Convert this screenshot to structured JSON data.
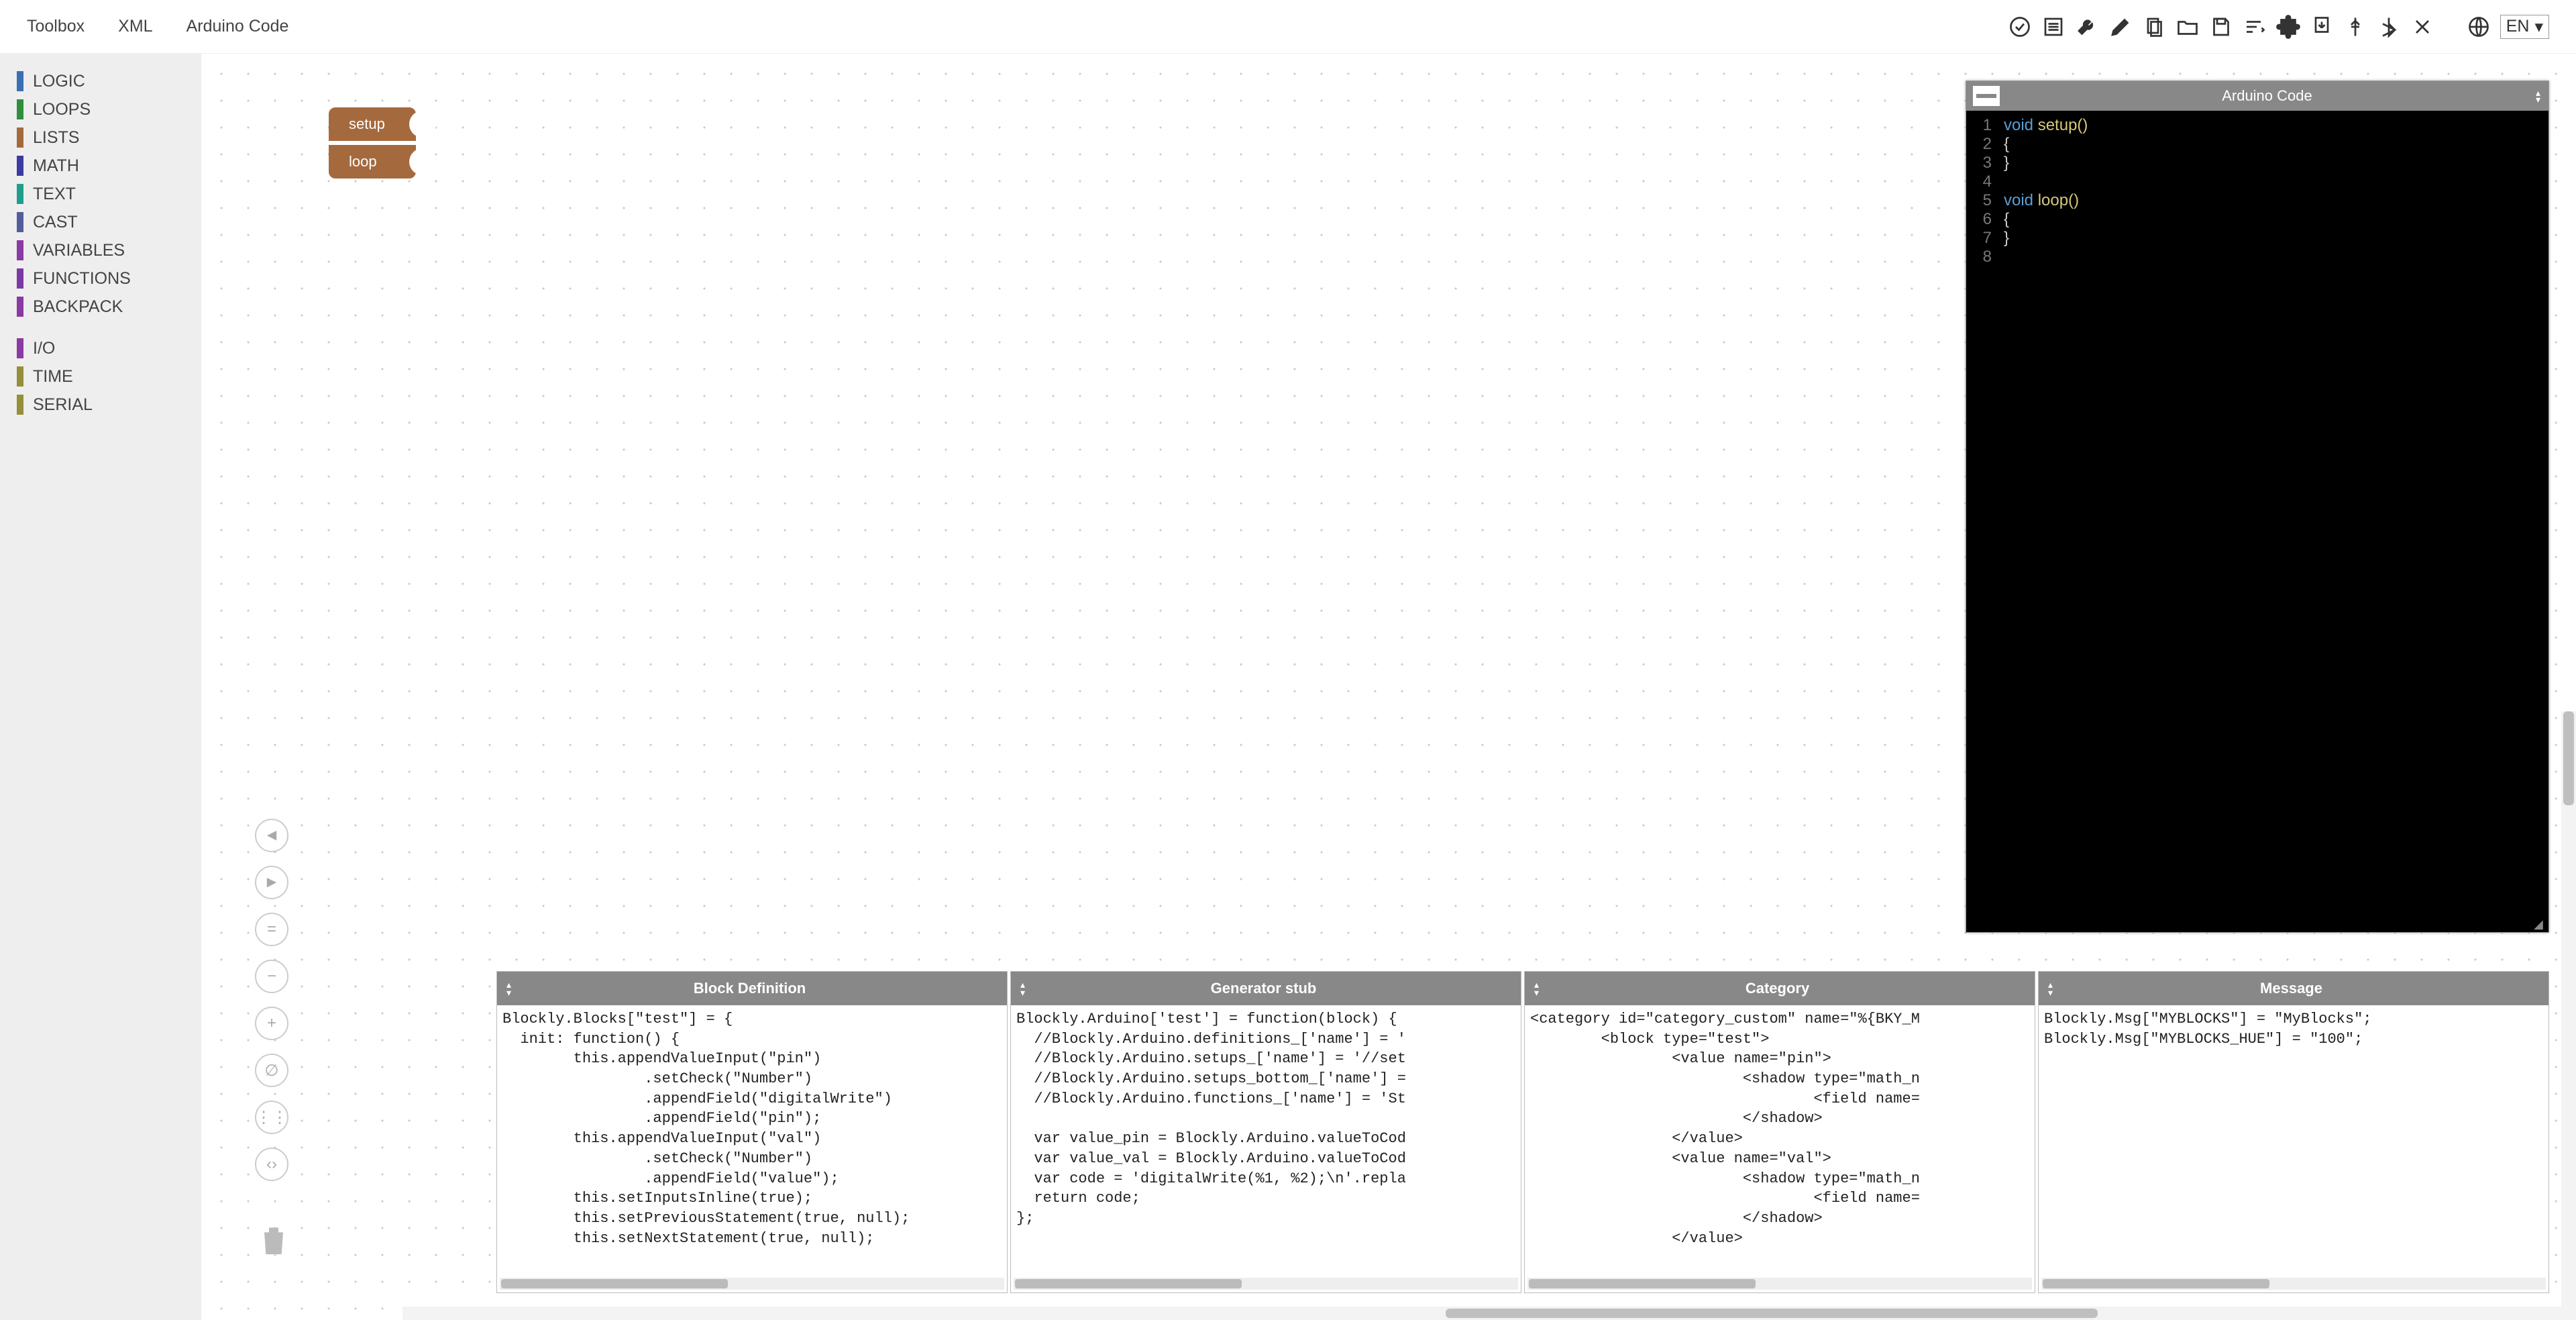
{
  "tabs": {
    "toolbox": "Toolbox",
    "xml": "XML",
    "arduino": "Arduino Code"
  },
  "lang": "EN",
  "categories": [
    {
      "label": "LOGIC",
      "color": "#3b6fb5"
    },
    {
      "label": "LOOPS",
      "color": "#2f8f3d"
    },
    {
      "label": "LISTS",
      "color": "#a46a3e"
    },
    {
      "label": "MATH",
      "color": "#3d3aa3"
    },
    {
      "label": "TEXT",
      "color": "#1f9e8d"
    },
    {
      "label": "CAST",
      "color": "#535d9c"
    },
    {
      "label": "VARIABLES",
      "color": "#8a3aa3"
    },
    {
      "label": "FUNCTIONS",
      "color": "#7a3aa3"
    },
    {
      "label": "BACKPACK",
      "color": "#8a3aa3"
    }
  ],
  "categories2": [
    {
      "label": "I/O",
      "color": "#8a3aa3"
    },
    {
      "label": "TIME",
      "color": "#938f3a"
    },
    {
      "label": "SERIAL",
      "color": "#938f3a"
    }
  ],
  "block": {
    "setup": "setup",
    "loop": "loop"
  },
  "codePanel": {
    "title": "Arduino Code",
    "lines": [
      {
        "n": "1",
        "kw": "void",
        "fn": " setup()",
        "rest": ""
      },
      {
        "n": "2",
        "kw": "",
        "fn": "",
        "rest": "{"
      },
      {
        "n": "3",
        "kw": "",
        "fn": "",
        "rest": "}"
      },
      {
        "n": "4",
        "kw": "",
        "fn": "",
        "rest": ""
      },
      {
        "n": "5",
        "kw": "void",
        "fn": " loop()",
        "rest": ""
      },
      {
        "n": "6",
        "kw": "",
        "fn": "",
        "rest": "{"
      },
      {
        "n": "7",
        "kw": "",
        "fn": "",
        "rest": "}"
      },
      {
        "n": "8",
        "kw": "",
        "fn": "",
        "rest": ""
      }
    ]
  },
  "bottomPanels": {
    "blockDef": {
      "title": "Block Definition",
      "code": "Blockly.Blocks[\"test\"] = {\n  init: function() {\n        this.appendValueInput(\"pin\")\n                .setCheck(\"Number\")\n                .appendField(\"digitalWrite\")\n                .appendField(\"pin\");\n        this.appendValueInput(\"val\")\n                .setCheck(\"Number\")\n                .appendField(\"value\");\n        this.setInputsInline(true);\n        this.setPreviousStatement(true, null);\n        this.setNextStatement(true, null);"
    },
    "genStub": {
      "title": "Generator stub",
      "code": "Blockly.Arduino['test'] = function(block) {\n  //Blockly.Arduino.definitions_['name'] = '\n  //Blockly.Arduino.setups_['name'] = '//set\n  //Blockly.Arduino.setups_bottom_['name'] =\n  //Blockly.Arduino.functions_['name'] = 'St\n\n  var value_pin = Blockly.Arduino.valueToCod\n  var value_val = Blockly.Arduino.valueToCod\n  var code = 'digitalWrite(%1, %2);\\n'.repla\n  return code;\n};"
    },
    "category": {
      "title": "Category",
      "code": "<category id=\"category_custom\" name=\"%{BKY_M\n        <block type=\"test\">\n                <value name=\"pin\">\n                        <shadow type=\"math_n\n                                <field name=\n                        </shadow>\n                </value>\n                <value name=\"val\">\n                        <shadow type=\"math_n\n                                <field name=\n                        </shadow>\n                </value>"
    },
    "message": {
      "title": "Message",
      "code": "Blockly.Msg[\"MYBLOCKS\"] = \"MyBlocks\";\nBlockly.Msg[\"MYBLOCKS_HUE\"] = \"100\";"
    }
  },
  "zoomGlyphs": [
    "◄",
    "►",
    "=",
    "−",
    "+",
    "∅",
    "⋮⋮",
    "‹›"
  ]
}
